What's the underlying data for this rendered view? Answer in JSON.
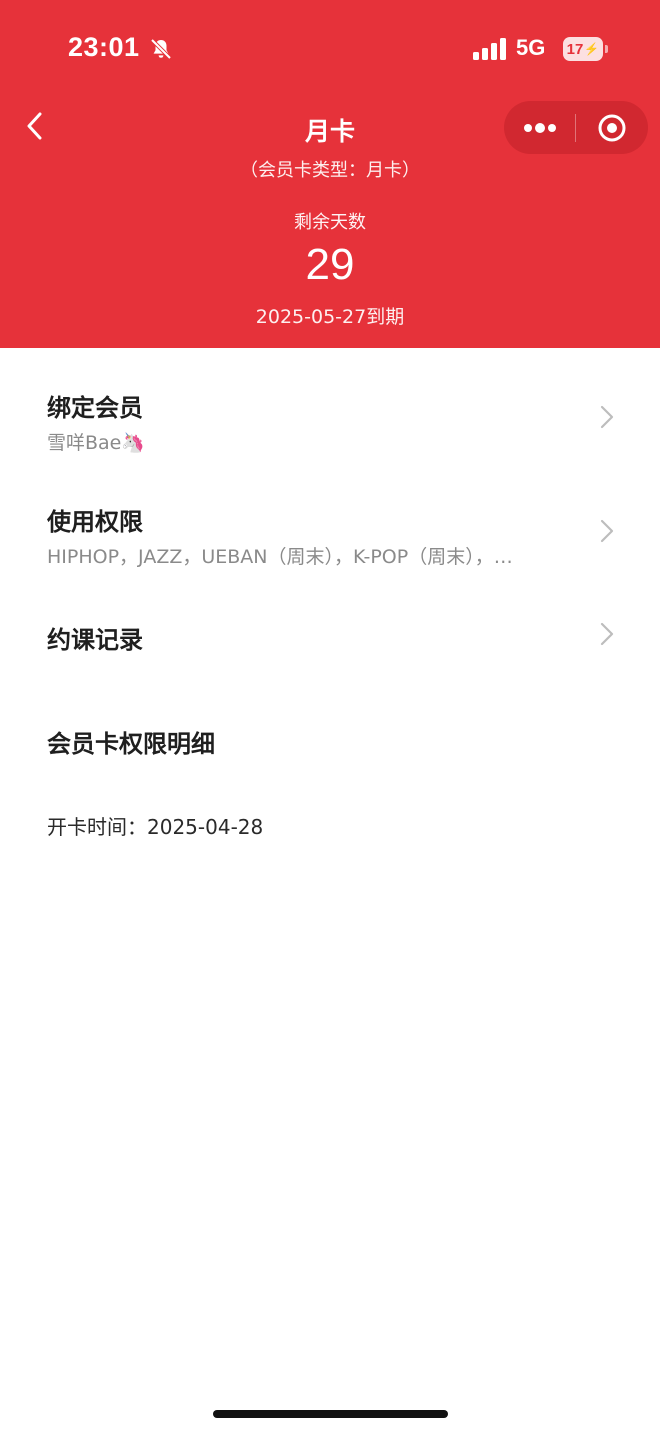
{
  "status_bar": {
    "time": "23:01",
    "network": "5G",
    "battery": "17"
  },
  "header": {
    "title": "月卡",
    "card_type": "（会员卡类型：月卡）",
    "remaining_label": "剩余天数",
    "remaining_days": "29",
    "expire_text": "2025-05-27到期",
    "background_color": "#e6323a"
  },
  "rows": {
    "bound_member": {
      "title": "绑定会员",
      "value": "雪咩Bae🦄"
    },
    "permissions": {
      "title": "使用权限",
      "value": "HIPHOP，JAZZ，UEBAN（周末），K-POP（周末），…"
    },
    "booking_records": {
      "title": "约课记录"
    }
  },
  "details": {
    "title": "会员卡权限明细",
    "open_date": "开卡时间：2025-04-28"
  },
  "icons": [
    "bell-slash-icon",
    "signal-icon",
    "battery-icon",
    "back-chevron-icon",
    "more-dots-icon",
    "target-close-icon",
    "chevron-right-icon"
  ]
}
